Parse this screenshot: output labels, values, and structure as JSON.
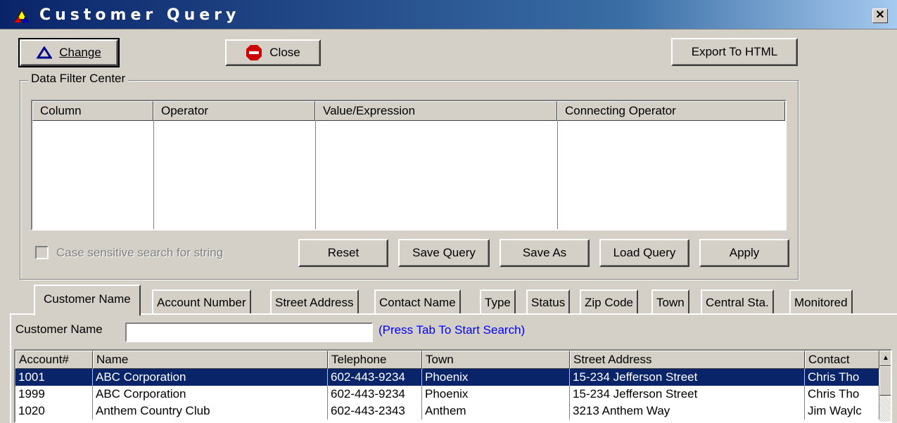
{
  "window": {
    "title": "Customer Query",
    "close_glyph": "✕"
  },
  "toolbar": {
    "change_label": "Change",
    "close_label": "Close",
    "export_label": "Export To HTML"
  },
  "filter": {
    "group_label": "Data Filter Center",
    "columns": [
      "Column",
      "Operator",
      "Value/Expression",
      "Connecting Operator"
    ],
    "case_sensitive_label": "Case sensitive search for string",
    "case_sensitive_checked": false,
    "buttons": {
      "reset": "Reset",
      "save_query": "Save Query",
      "save_as": "Save As",
      "load_query": "Load Query",
      "apply": "Apply"
    }
  },
  "tabs": [
    "Customer Name",
    "Account Number",
    "Street Address",
    "Contact Name",
    "Type",
    "Status",
    "Zip Code",
    "Town",
    "Central Sta.",
    "Monitored"
  ],
  "active_tab": "Customer Name",
  "search": {
    "label": "Customer Name",
    "value": "",
    "hint": "(Press Tab To Start Search)"
  },
  "results": {
    "headers": [
      "Account#",
      "Name",
      "Telephone",
      "Town",
      "Street Address",
      "Contact"
    ],
    "rows": [
      [
        "1001",
        "ABC Corporation",
        "602-443-9234",
        "Phoenix",
        "15-234 Jefferson Street",
        "Chris Tho"
      ],
      [
        "1999",
        "ABC Corporation",
        "602-443-9234",
        "Phoenix",
        "15-234 Jefferson Street",
        "Chris Tho"
      ],
      [
        "1020",
        "Anthem Country Club",
        "602-443-2343",
        "Anthem",
        "3213 Anthem Way",
        "Jim Waylc"
      ]
    ],
    "selected_row": 0
  },
  "icons": {
    "app": "app-triangle-icon",
    "change": "triangle-icon",
    "close": "stop-sign-icon",
    "scroll_up": "arrow-up-icon"
  },
  "colors": {
    "title_bar": "#0a246a",
    "selection": "#0a246a",
    "hint": "#0000ff",
    "close_icon": "#cc0000"
  }
}
